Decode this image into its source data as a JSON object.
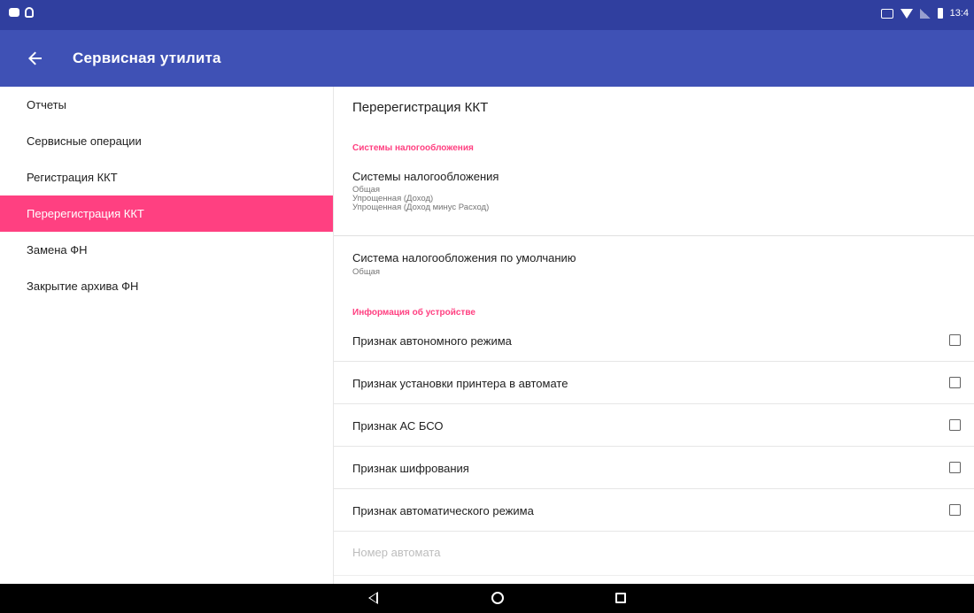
{
  "status_bar": {
    "time": "13:4"
  },
  "app_bar": {
    "title": "Сервисная утилита",
    "back_icon": "arrow-back-icon"
  },
  "sidebar": {
    "items": [
      {
        "label": "Отчеты",
        "active": false
      },
      {
        "label": "Сервисные операции",
        "active": false
      },
      {
        "label": "Регистрация ККТ",
        "active": false
      },
      {
        "label": "Перерегистрация ККТ",
        "active": true
      },
      {
        "label": "Замена ФН",
        "active": false
      },
      {
        "label": "Закрытие архива ФН",
        "active": false
      }
    ]
  },
  "content": {
    "title": "Перерегистрация ККТ",
    "section_tax": "Системы налогообложения",
    "tax_systems": {
      "title": "Системы налогообложения",
      "values": [
        "Общая",
        "Упрощенная (Доход)",
        "Упрощенная (Доход минус Расход)"
      ]
    },
    "default_tax": {
      "title": "Система налогообложения по умолчанию",
      "value": "Общая"
    },
    "section_device": "Информация об устройстве",
    "checkboxes": [
      {
        "label": "Признак автономного режима",
        "checked": false
      },
      {
        "label": "Признак установки принтера в автомате",
        "checked": false
      },
      {
        "label": "Признак АС БСО",
        "checked": false
      },
      {
        "label": "Признак шифрования",
        "checked": false
      },
      {
        "label": "Признак автоматического режима",
        "checked": false
      }
    ],
    "machine_number": {
      "title": "Номер автомата",
      "enabled": false
    }
  },
  "colors": {
    "status_bar": "#303f9f",
    "app_bar": "#3f51b5",
    "accent": "#ff4081",
    "nav_bar": "#000000"
  }
}
